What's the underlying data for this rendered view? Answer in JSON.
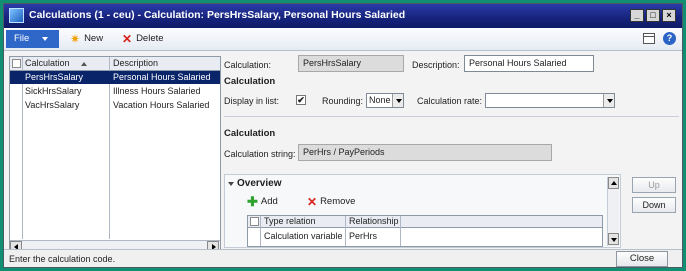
{
  "window": {
    "title": "Calculations (1 - ceu) - Calculation: PersHrsSalary, Personal Hours Salaried",
    "controls": {
      "minimize": "_",
      "maximize": "□",
      "close": "×"
    }
  },
  "toolbar": {
    "file_label": "File",
    "new_label": "New",
    "delete_label": "Delete"
  },
  "list": {
    "headers": {
      "calculation": "Calculation",
      "description": "Description"
    },
    "rows": [
      {
        "calculation": "PersHrsSalary",
        "description": "Personal Hours Salaried",
        "selected": true
      },
      {
        "calculation": "SickHrsSalary",
        "description": "Illness Hours Salaried",
        "selected": false
      },
      {
        "calculation": "VacHrsSalary",
        "description": "Vacation Hours Salaried",
        "selected": false
      }
    ]
  },
  "detail": {
    "calculation_label": "Calculation:",
    "calculation_value": "PersHrsSalary",
    "description_label": "Description:",
    "description_value": "Personal Hours Salaried",
    "section1_title": "Calculation",
    "display_in_list_label": "Display in list:",
    "display_in_list_checked": true,
    "check_mark": "✔",
    "rounding_label": "Rounding:",
    "rounding_value": "None",
    "calculation_rate_label": "Calculation rate:",
    "calculation_rate_value": "",
    "section2_title": "Calculation",
    "calculation_string_label": "Calculation string:",
    "calculation_string_value": "PerHrs / PayPeriods"
  },
  "overview": {
    "title": "Overview",
    "add_label": "Add",
    "remove_label": "Remove",
    "headers": {
      "type_relation": "Type relation",
      "relationship": "Relationship"
    },
    "rows": [
      {
        "type_relation": "Calculation variable",
        "relationship": "PerHrs"
      }
    ]
  },
  "side_buttons": {
    "up_label": "Up",
    "down_label": "Down"
  },
  "status": {
    "message": "Enter the calculation code.",
    "close_label": "Close"
  },
  "colors": {
    "frame": "#118f73",
    "titlebar": "#16237c",
    "selection": "#0a246a",
    "file_button": "#2f67c9"
  }
}
